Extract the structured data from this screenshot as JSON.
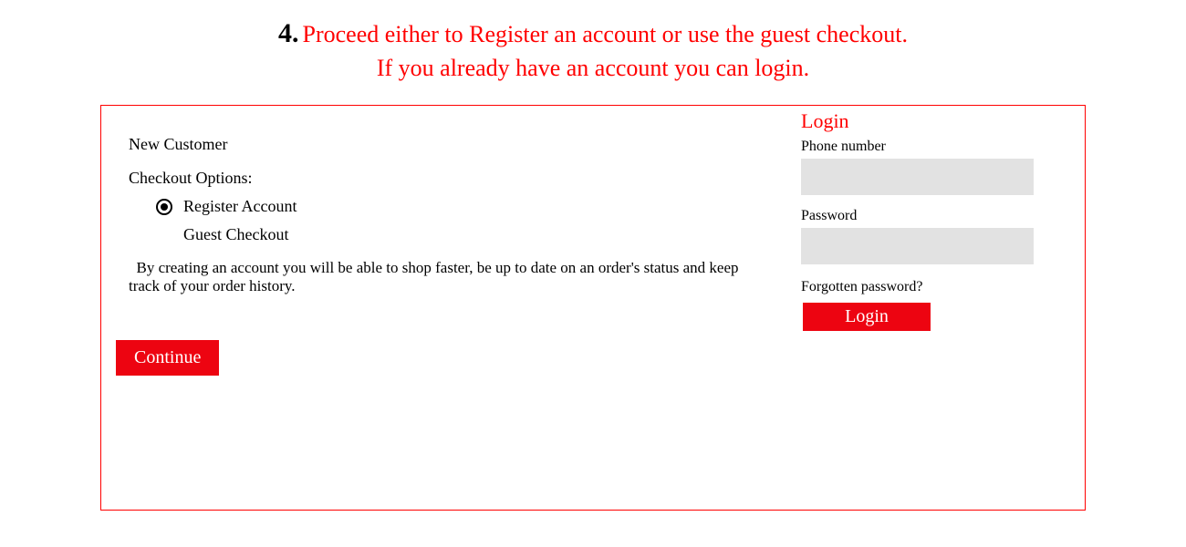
{
  "header": {
    "step_number": "4.",
    "step_text": " Proceed either to Register an account or use the guest checkout.",
    "step_subtext": "If you already have an account you can login."
  },
  "left": {
    "new_customer": "New Customer",
    "checkout_options": "Checkout Options:",
    "register_account": "Register Account",
    "guest_checkout": "Guest Checkout",
    "description": "  By creating an account you will be able to shop faster, be up to date on an order's status and keep track of your order history.",
    "continue": "Continue"
  },
  "right": {
    "login_title": "Login",
    "phone_label": "Phone number",
    "password_label": "Password",
    "forgot": "Forgotten password?",
    "login_button": "Login"
  }
}
